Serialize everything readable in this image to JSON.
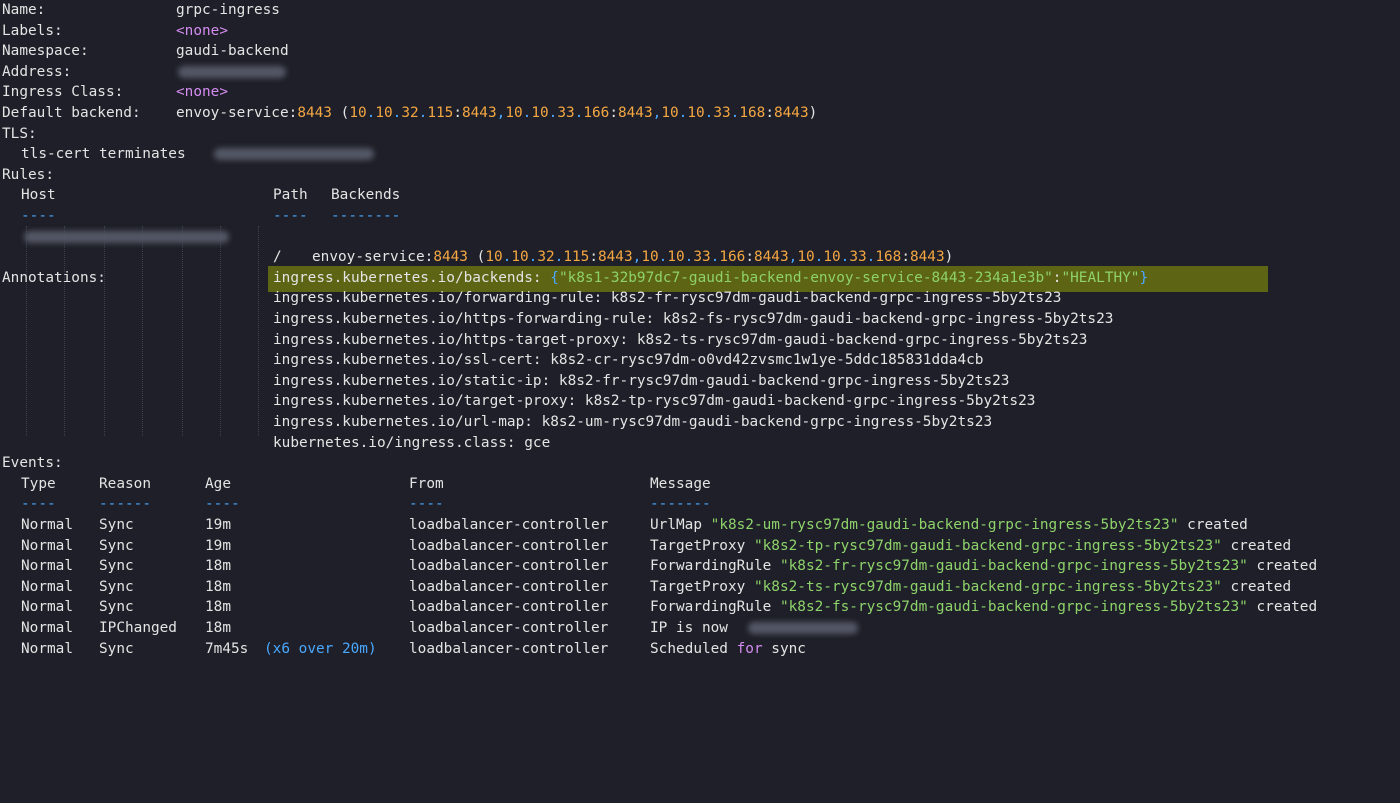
{
  "header": {
    "name": {
      "label": "Name:",
      "value": "grpc-ingress"
    },
    "labels": {
      "label": "Labels:",
      "value": "<none>"
    },
    "namespace": {
      "label": "Namespace:",
      "value": "gaudi-backend"
    },
    "address": {
      "label": "Address:"
    },
    "ingress_class": {
      "label": "Ingress Class:",
      "value": "<none>"
    },
    "default_backend": {
      "label": "Default backend:",
      "service": "envoy-service",
      "port": "8443",
      "endpoints": [
        {
          "a": "10",
          "b": "10",
          "c": "32",
          "d": "115",
          "port": "8443"
        },
        {
          "a": "10",
          "b": "10",
          "c": "33",
          "d": "166",
          "port": "8443"
        },
        {
          "a": "10",
          "b": "10",
          "c": "33",
          "d": "168",
          "port": "8443"
        }
      ]
    }
  },
  "tls": {
    "label": "TLS:",
    "entry": "tls-cert terminates"
  },
  "rules": {
    "label": "Rules:",
    "headers": {
      "host": "Host",
      "path": "Path",
      "backends": "Backends"
    },
    "underlines": {
      "host": "----",
      "path": "----",
      "backends": "--------"
    },
    "row": {
      "path": "/",
      "service": "envoy-service",
      "port": "8443",
      "endpoints": [
        {
          "a": "10",
          "b": "10",
          "c": "32",
          "d": "115",
          "port": "8443"
        },
        {
          "a": "10",
          "b": "10",
          "c": "33",
          "d": "166",
          "port": "8443"
        },
        {
          "a": "10",
          "b": "10",
          "c": "33",
          "d": "168",
          "port": "8443"
        }
      ]
    }
  },
  "annotations": {
    "label": "Annotations:",
    "backends": {
      "key": "ingress.kubernetes.io/backends:",
      "name": "k8s1-32b97dc7-gaudi-backend-envoy-service-8443-234a1e3b",
      "status": "HEALTHY"
    },
    "items": [
      "ingress.kubernetes.io/forwarding-rule: k8s2-fr-rysc97dm-gaudi-backend-grpc-ingress-5by2ts23",
      "ingress.kubernetes.io/https-forwarding-rule: k8s2-fs-rysc97dm-gaudi-backend-grpc-ingress-5by2ts23",
      "ingress.kubernetes.io/https-target-proxy: k8s2-ts-rysc97dm-gaudi-backend-grpc-ingress-5by2ts23",
      "ingress.kubernetes.io/ssl-cert: k8s2-cr-rysc97dm-o0vd42zvsmc1w1ye-5ddc185831dda4cb",
      "ingress.kubernetes.io/static-ip: k8s2-fr-rysc97dm-gaudi-backend-grpc-ingress-5by2ts23",
      "ingress.kubernetes.io/target-proxy: k8s2-tp-rysc97dm-gaudi-backend-grpc-ingress-5by2ts23",
      "ingress.kubernetes.io/url-map: k8s2-um-rysc97dm-gaudi-backend-grpc-ingress-5by2ts23",
      "kubernetes.io/ingress.class: gce"
    ]
  },
  "events": {
    "label": "Events:",
    "headers": {
      "type": "Type",
      "reason": "Reason",
      "age": "Age",
      "from": "From",
      "message": "Message"
    },
    "underlines": {
      "type": "----",
      "reason": "------",
      "age": "----",
      "from": "----",
      "message": "-------"
    },
    "rows": [
      {
        "type": "Normal",
        "reason": "Sync",
        "age": "19m",
        "from": "loadbalancer-controller",
        "msg_pre": "UrlMap ",
        "msg_quoted": "\"k8s2-um-rysc97dm-gaudi-backend-grpc-ingress-5by2ts23\"",
        "msg_post": " created"
      },
      {
        "type": "Normal",
        "reason": "Sync",
        "age": "19m",
        "from": "loadbalancer-controller",
        "msg_pre": "TargetProxy ",
        "msg_quoted": "\"k8s2-tp-rysc97dm-gaudi-backend-grpc-ingress-5by2ts23\"",
        "msg_post": " created"
      },
      {
        "type": "Normal",
        "reason": "Sync",
        "age": "18m",
        "from": "loadbalancer-controller",
        "msg_pre": "ForwardingRule ",
        "msg_quoted": "\"k8s2-fr-rysc97dm-gaudi-backend-grpc-ingress-5by2ts23\"",
        "msg_post": " created"
      },
      {
        "type": "Normal",
        "reason": "Sync",
        "age": "18m",
        "from": "loadbalancer-controller",
        "msg_pre": "TargetProxy ",
        "msg_quoted": "\"k8s2-ts-rysc97dm-gaudi-backend-grpc-ingress-5by2ts23\"",
        "msg_post": " created"
      },
      {
        "type": "Normal",
        "reason": "Sync",
        "age": "18m",
        "from": "loadbalancer-controller",
        "msg_pre": "ForwardingRule ",
        "msg_quoted": "\"k8s2-fs-rysc97dm-gaudi-backend-grpc-ingress-5by2ts23\"",
        "msg_post": " created"
      },
      {
        "type": "Normal",
        "reason": "IPChanged",
        "age": "18m",
        "from": "loadbalancer-controller",
        "msg_pre": "IP is now",
        "msg_quoted": "",
        "msg_post": ""
      }
    ],
    "last_row": {
      "type": "Normal",
      "reason": "Sync",
      "age": "7m45s",
      "age_extra": "(x6 over 20m)",
      "from": "loadbalancer-controller",
      "msg_pre": "Scheduled ",
      "msg_for": "for",
      "msg_post": " sync"
    }
  },
  "colors": {
    "background": "#1e1f28",
    "text": "#e4e4e4",
    "number": "#f5a742",
    "punct": "#4aa8ff",
    "string": "#8ed36a",
    "keyword": "#d48cf0",
    "highlight": "#5d6414"
  }
}
